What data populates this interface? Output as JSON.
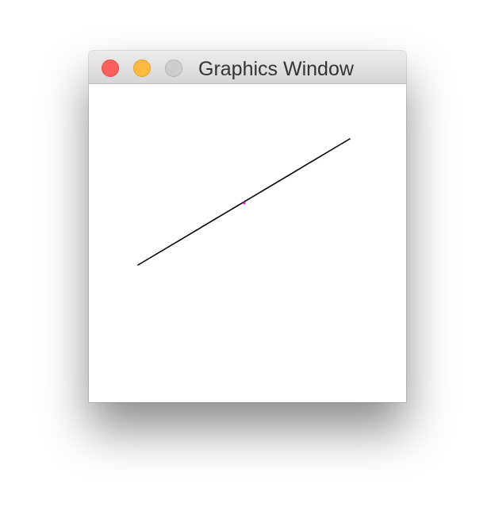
{
  "window": {
    "title": "Graphics Window"
  },
  "controls": {
    "close": "close-icon",
    "minimize": "minimize-icon",
    "zoom": "zoom-icon"
  },
  "colors": {
    "close": "#fc605c",
    "minimize": "#fdbc40",
    "zoom": "#cdcdcd",
    "line": "#000000",
    "marker": "#e020e0",
    "canvas_background": "#ffffff"
  },
  "drawing": {
    "shape": "line",
    "marker": "point"
  }
}
